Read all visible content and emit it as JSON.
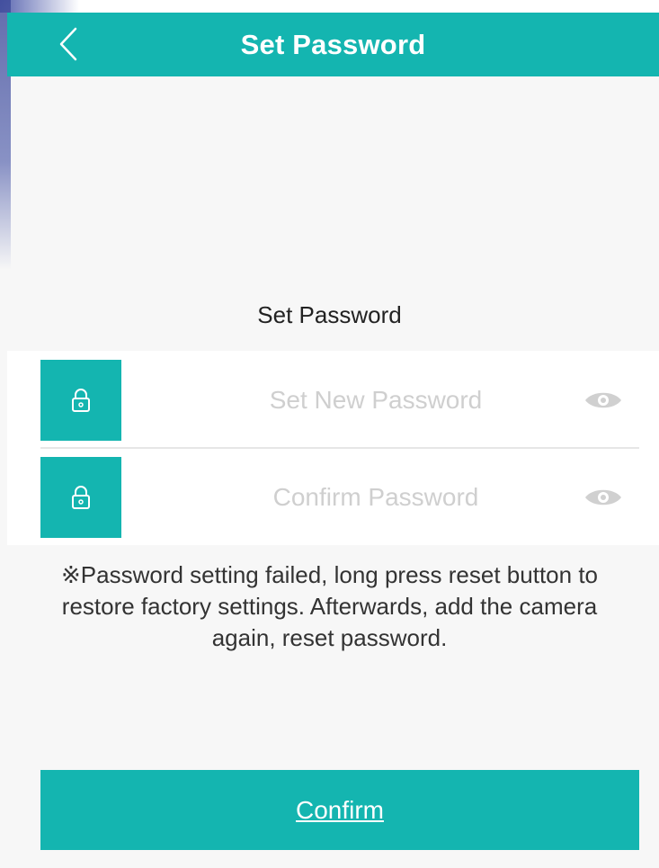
{
  "nav": {
    "title": "Set Password",
    "back_icon": "chevron-left-icon"
  },
  "section_title": "Set Password",
  "fields": [
    {
      "placeholder": "Set New Password",
      "value": "",
      "lock_icon": "lock-icon",
      "toggle_icon": "eye-icon"
    },
    {
      "placeholder": "Confirm Password",
      "value": "",
      "lock_icon": "lock-icon",
      "toggle_icon": "eye-icon"
    }
  ],
  "notice": "※Password setting failed, long press reset button to restore factory settings. Afterwards, add the camera again, reset password.",
  "confirm_label": "Confirm",
  "colors": {
    "accent": "#14b5b0",
    "background": "#f7f7f7",
    "placeholder": "#cfcfcf",
    "eye_icon": "#d0d0d0"
  }
}
